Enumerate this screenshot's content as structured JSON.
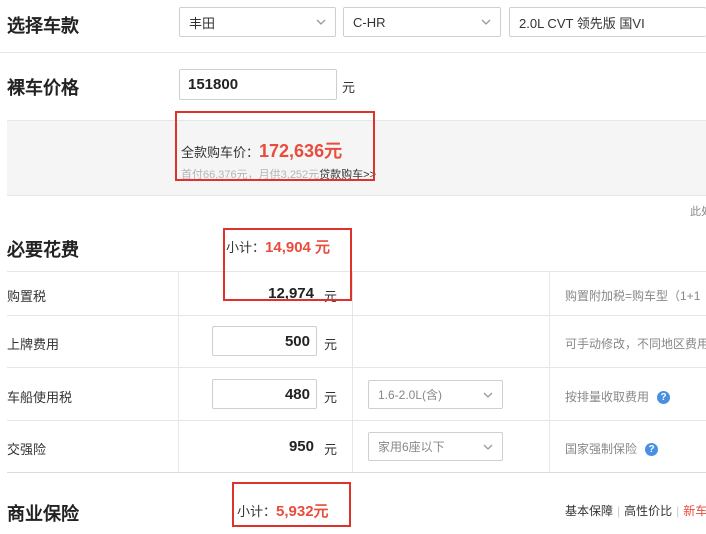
{
  "car_select": {
    "heading": "选择车款",
    "brand": "丰田",
    "model": "C-HR",
    "trim": "2.0L CVT 领先版 国VI"
  },
  "price": {
    "heading": "裸车价格",
    "value": "151800",
    "unit": "元"
  },
  "summary": {
    "total_label": "全款购车价：",
    "total_value": "172,636元",
    "loan_text": "首付66,376元，月供3,252元",
    "loan_link": "贷款购车>>",
    "edge_text": "此处"
  },
  "required": {
    "heading": "必要花费",
    "subtotal_label": "小计：",
    "subtotal_value": "14,904 元",
    "rows": [
      {
        "label": "购置税",
        "value": "12,974",
        "unit": "元",
        "note": "购置附加税=购车型（1+1"
      },
      {
        "label": "上牌费用",
        "value": "500",
        "unit": "元",
        "note": "可手动修改，不同地区费用"
      },
      {
        "label": "车船使用税",
        "value": "480",
        "unit": "元",
        "option": "1.6-2.0L(含)",
        "note": "按排量收取费用"
      },
      {
        "label": "交强险",
        "value": "950",
        "unit": "元",
        "option": "家用6座以下",
        "note": "国家强制保险"
      }
    ]
  },
  "insurance": {
    "heading": "商业保险",
    "subtotal_label": "小计：",
    "subtotal_value": "5,932元",
    "tabs": [
      "基本保障",
      "高性价比",
      "新车"
    ]
  },
  "colors": {
    "accent_red": "#e84c3d",
    "annotation_red": "#e0322d",
    "help_blue": "#4a90e2"
  }
}
